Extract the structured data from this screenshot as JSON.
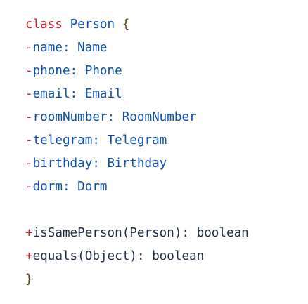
{
  "code": {
    "header": {
      "keyword": "class",
      "name": "Person",
      "open": "{"
    },
    "fields": [
      {
        "prefix": "-",
        "text": "name: Name"
      },
      {
        "prefix": "-",
        "text": "phone: Phone"
      },
      {
        "prefix": "-",
        "text": "email: Email"
      },
      {
        "prefix": "-",
        "text": "roomNumber: RoomNumber"
      },
      {
        "prefix": "-",
        "text": "telegram: Telegram"
      },
      {
        "prefix": "-",
        "text": "birthday: Birthday"
      },
      {
        "prefix": "-",
        "text": "dorm: Dorm"
      }
    ],
    "methods": [
      {
        "prefix": "+",
        "text": "isSamePerson(Person): boolean"
      },
      {
        "prefix": "+",
        "text": "equals(Object): boolean"
      }
    ],
    "close": "}"
  },
  "colors": {
    "keyword": "#cf222e",
    "type": "#0b4fa8",
    "method": "#1b2b45",
    "brace": "#5c3d10"
  }
}
